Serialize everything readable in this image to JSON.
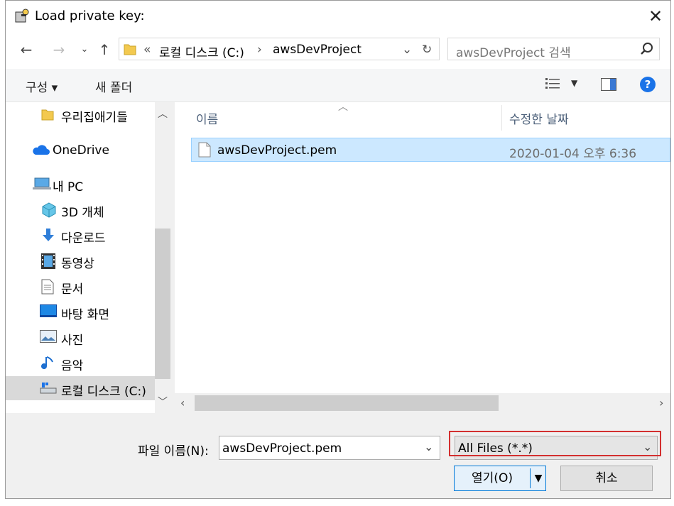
{
  "window": {
    "title": "Load private key:"
  },
  "nav": {
    "breadcrumb_prefix": "«",
    "breadcrumb": [
      "로컬 디스크 (C:)",
      "awsDevProject"
    ],
    "search_placeholder": "awsDevProject 검색"
  },
  "toolbar": {
    "organize_label": "구성 ▾",
    "new_folder_label": "새 폴더"
  },
  "sidebar": {
    "items": [
      {
        "label": "우리집애기들",
        "icon": "folder-icon"
      },
      {
        "label": "OneDrive",
        "icon": "cloud-icon"
      },
      {
        "label": "내 PC",
        "icon": "computer-icon"
      },
      {
        "label": "3D 개체",
        "icon": "cube-icon"
      },
      {
        "label": "다운로드",
        "icon": "download-icon"
      },
      {
        "label": "동영상",
        "icon": "video-icon"
      },
      {
        "label": "문서",
        "icon": "document-icon"
      },
      {
        "label": "바탕 화면",
        "icon": "desktop-icon"
      },
      {
        "label": "사진",
        "icon": "picture-icon"
      },
      {
        "label": "음악",
        "icon": "music-icon"
      },
      {
        "label": "로컬 디스크 (C:)",
        "icon": "drive-icon"
      }
    ]
  },
  "files": {
    "columns": [
      "이름",
      "수정한 날짜"
    ],
    "rows": [
      {
        "name": "awsDevProject.pem",
        "modified": "2020-01-04 오후 6:36"
      }
    ]
  },
  "footer": {
    "filename_label": "파일 이름(N):",
    "filename_value": "awsDevProject.pem",
    "filetype_value": "All Files (*.*)",
    "open_label": "열기(O)",
    "cancel_label": "취소"
  },
  "colors": {
    "selection": "#cce8ff",
    "accent_outline": "#d32f2f",
    "help": "#1a73e8"
  }
}
